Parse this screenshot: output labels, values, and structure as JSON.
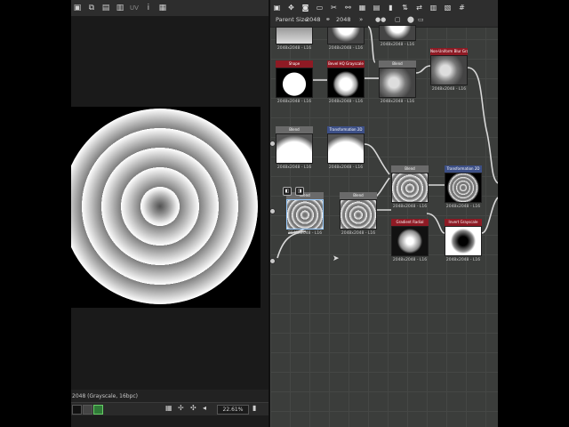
{
  "view2d": {
    "toolbar_text": "UV",
    "status": "2048 (Grayscale, 16bpc)",
    "zoom": "22.61%"
  },
  "graph": {
    "parent_size_label": "Parent Size:",
    "parent_size_value": "2048",
    "size_value": "2048"
  },
  "nodes": [
    {
      "id": "n1",
      "title": "",
      "label": "2048x2048 - L16",
      "thumb": "th-top"
    },
    {
      "id": "n2",
      "title": "",
      "label": "2048x2048 - L16",
      "thumb": "th-top2"
    },
    {
      "id": "n3",
      "title": "",
      "label": "2048x2048 - L16",
      "thumb": "th-top2"
    },
    {
      "id": "n4",
      "title": "Shape",
      "label": "2048x2048 - L16",
      "thumb": "th-white-disc"
    },
    {
      "id": "n5",
      "title": "Bevel HQ Grayscale",
      "label": "2048x2048 - L16",
      "thumb": "th-soft-disc"
    },
    {
      "id": "n6",
      "title": "Blend",
      "label": "2048x2048 - L16",
      "thumb": "th-blob"
    },
    {
      "id": "n7",
      "title": "Non-Uniform Blur Grays...",
      "label": "2048x2048 - L16",
      "thumb": "th-blob"
    },
    {
      "id": "n8",
      "title": "Blend",
      "label": "2048x2048 - L16",
      "thumb": "th-halfdisc"
    },
    {
      "id": "n9",
      "title": "Transformation 2D",
      "label": "2048x2048 - L16",
      "thumb": "th-halfdisc"
    },
    {
      "id": "n10",
      "title": "Blend",
      "label": "2048x2048 - L16",
      "thumb": "th-rings"
    },
    {
      "id": "n11",
      "title": "Transformation 2D",
      "label": "2048x2048 - L16",
      "thumb": "th-rings-dark"
    },
    {
      "id": "n12",
      "title": "Blend",
      "label": "2048x2048 - L16",
      "thumb": "th-rings"
    },
    {
      "id": "n13",
      "title": "Blend",
      "label": "2048x2048 - L16",
      "thumb": "th-rings"
    },
    {
      "id": "n14",
      "title": "Gradient Radial",
      "label": "2048x2048 - L16",
      "thumb": "th-grad-disc"
    },
    {
      "id": "n15",
      "title": "Invert Grayscale",
      "label": "2048x2048 - L16",
      "thumb": "th-inv-disc"
    }
  ]
}
